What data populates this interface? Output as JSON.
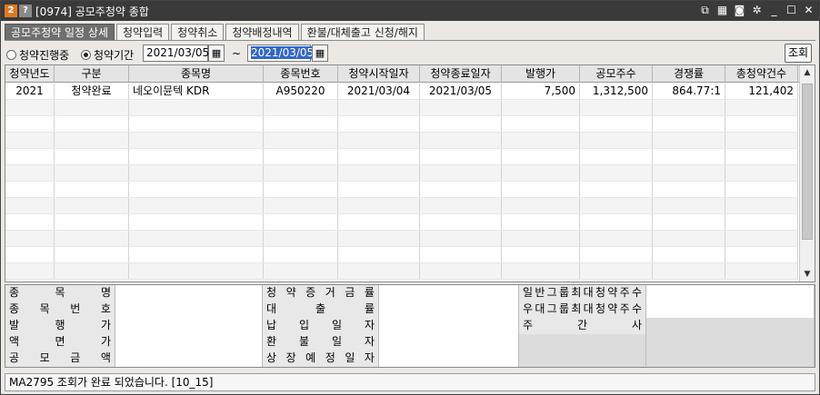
{
  "titlebar": {
    "badge_num": "2",
    "badge_help": "?",
    "title": "[0974] 공모주청약 종합",
    "icons": [
      "link-icon",
      "grid-icon",
      "camera-icon",
      "gear-icon",
      "minimize-icon",
      "maximize-icon",
      "close-icon"
    ]
  },
  "tabs": [
    {
      "label": "공모주청약 일정 상세",
      "active": true
    },
    {
      "label": "청약입력",
      "active": false
    },
    {
      "label": "청약취소",
      "active": false
    },
    {
      "label": "청약배정내역",
      "active": false
    },
    {
      "label": "환불/대체출고 신청/해지",
      "active": false
    }
  ],
  "filter": {
    "radio_ongoing": "청약진행중",
    "radio_period": "청약기간",
    "selected": "radio_period",
    "date_from": "2021/03/05",
    "tilde": "~",
    "date_to": "2021/03/05",
    "query_button": "조회"
  },
  "grid": {
    "columns": [
      "청약년도",
      "구분",
      "종목명",
      "종목번호",
      "청약시작일자",
      "청약종료일자",
      "발행가",
      "공모주수",
      "경쟁률",
      "총청약건수"
    ],
    "rows": [
      [
        "2021",
        "청약완료",
        "네오이뮨텍 KDR",
        "A950220",
        "2021/03/04",
        "2021/03/05",
        "7,500",
        "1,312,500",
        "864.77:1",
        "121,402"
      ]
    ],
    "empty_rows": 11
  },
  "detail": {
    "col1": [
      "종목명",
      "종목번호",
      "발행가",
      "액면가",
      "공모금액"
    ],
    "col2": [
      "청약증거금률",
      "대출률",
      "납입일자",
      "환불일자",
      "상장예정일자"
    ],
    "col3": [
      "일반그룹최대청약주수",
      "우대그룹최대청약주수",
      "주간사",
      "",
      ""
    ]
  },
  "status": {
    "message": "MA2795 조회가 완료 되었습니다. [10_15]"
  }
}
